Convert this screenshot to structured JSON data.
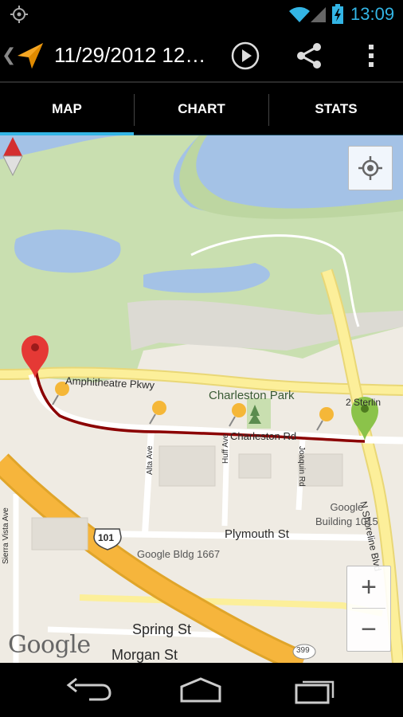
{
  "status_bar": {
    "time": "13:09"
  },
  "action_bar": {
    "title": "11/29/2012 12…"
  },
  "tabs": [
    {
      "label": "MAP"
    },
    {
      "label": "CHART"
    },
    {
      "label": "STATS"
    }
  ],
  "map": {
    "labels": {
      "amphitheatre": "Amphitheatre Pkwy",
      "charleston_park": "Charleston Park",
      "charleston_rd": "Charleston Rd",
      "shoreline": "N Shoreline Blvd",
      "sierra_vista": "Sierra Vista Ave",
      "alta": "Alta Ave",
      "huff": "Huff Ave",
      "joaquin": "Joaquin Rd",
      "plymouth": "Plymouth St",
      "google_bldg_1015": "Google\nBuilding 1015",
      "google_bldg_1667": "Google Bldg 1667",
      "hwy_101": "101",
      "hwy_399": "399",
      "spring": "Spring St",
      "morgan": "Morgan St",
      "sterlin": "2 Sterlin"
    },
    "zoom_in": "+",
    "zoom_out": "−",
    "attribution": "Google"
  },
  "colors": {
    "accent": "#33b5e5",
    "track": "#8b0000",
    "start_marker": "#8bc34a",
    "end_marker": "#e53935",
    "road": "#fcef9a",
    "water": "#a4c2e6",
    "park": "#c9dfb0"
  },
  "icons": {
    "gps": "gps-icon",
    "wifi": "wifi-icon",
    "signal": "signal-icon",
    "battery": "battery-icon",
    "app": "my-tracks-arrow-icon",
    "play": "play-icon",
    "share": "share-icon",
    "overflow": "overflow-menu-icon",
    "compass": "compass-icon",
    "my_location": "my-location-icon",
    "back": "back-icon",
    "home": "home-icon",
    "recents": "recents-icon"
  }
}
